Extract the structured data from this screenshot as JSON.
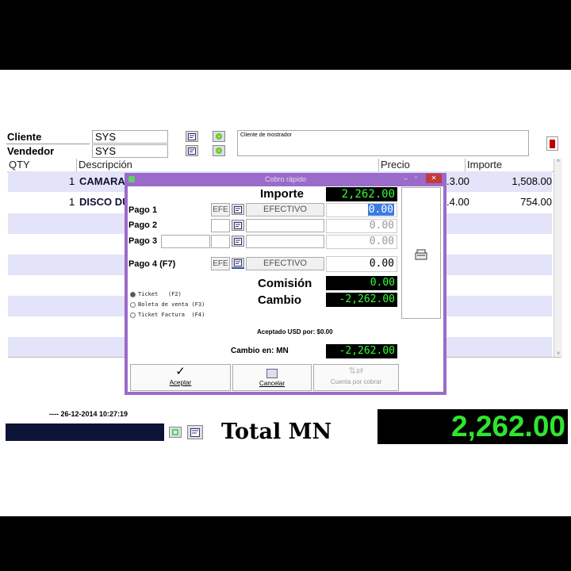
{
  "header": {
    "cliente_label": "Cliente",
    "cliente_value": "SYS",
    "vendedor_label": "Vendedor",
    "vendedor_value": "SYS",
    "cliente_name": "Cliente de mostrador"
  },
  "grid": {
    "columns": [
      "QTY",
      "Descripción",
      "Precio",
      "Importe"
    ],
    "rows": [
      {
        "qty": "1",
        "desc": "CAMARA",
        "precio_partial": ".3.00",
        "importe": "1,508.00"
      },
      {
        "qty": "1",
        "desc": "DISCO DU",
        "precio_partial": ".4.00",
        "importe": "754.00"
      }
    ]
  },
  "dialog": {
    "title": "Cobro rápido",
    "importe_label": "Importe",
    "importe_value": "2,262.00",
    "pagos": [
      {
        "label": "Pago 1",
        "code": "EFE",
        "method": "EFECTIVO",
        "amount": "0.00"
      },
      {
        "label": "Pago 2",
        "code": "",
        "method": "",
        "amount": "0.00"
      },
      {
        "label": "Pago 3",
        "code": "",
        "method": "",
        "amount": "0.00"
      },
      {
        "label": "Pago 4 (F7)",
        "code": "EFE",
        "method": "EFECTIVO",
        "amount": "0.00"
      }
    ],
    "comision_label": "Comisión",
    "comision_value": "0.00",
    "cambio_label": "Cambio",
    "cambio_value": "-2,262.00",
    "doc_types": [
      {
        "label": "Ticket",
        "key": "(F2)",
        "selected": true
      },
      {
        "label": "Boleta de venta",
        "key": "(F3)",
        "selected": false
      },
      {
        "label": "Ticket Factura",
        "key": "(F4)",
        "selected": false
      }
    ],
    "usd_text": "Aceptado USD por: $0.00",
    "cambio_en_label": "Cambio en: MN",
    "cambio_en_value": "-2,262.00",
    "buttons": {
      "accept": "Aceptar",
      "cancel": "Cancelar",
      "credit": "Cuenta por cobrar"
    }
  },
  "footer": {
    "datetime": "---- 26-12-2014 10:27:19",
    "total_label": "Total MN",
    "total_value": "2,262.00"
  },
  "colors": {
    "dialog_frame": "#9a6bc8",
    "display_green": "#33ff33",
    "row_lavender": "#e3e3f9"
  }
}
